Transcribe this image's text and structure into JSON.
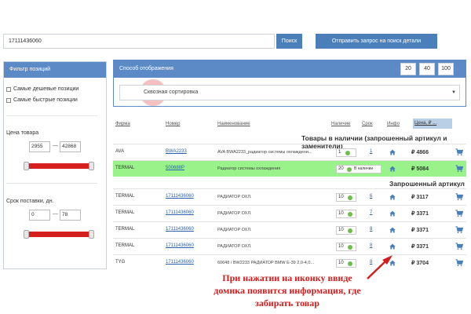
{
  "search": {
    "value": "17111436060",
    "button_label": "Поиск"
  },
  "request_button_label": "Отправить запрос на поиск детали",
  "filter": {
    "title": "Фильтр позиций",
    "options": [
      "Самые дешевые позиции",
      "Самые быстрые позиции"
    ],
    "price_label": "Цена товара",
    "price_min": "2955",
    "price_max": "42868",
    "delivery_label": "Срок поставки, дн.",
    "delivery_min": "0",
    "delivery_max": "78"
  },
  "display": {
    "title": "Способ отображения",
    "page_sizes": [
      "20",
      "40",
      "100"
    ],
    "mode_value": "Сквозная сортировка"
  },
  "table": {
    "headers": {
      "brand": "Фирма",
      "number": "Номер",
      "name": "Наименование",
      "availability": "Наличие",
      "term": "Срок",
      "info": "Инфо",
      "price": "Цена, ₽ ..."
    },
    "section_in_stock": "Товары в наличии (запрошенный артикул и заменители)",
    "section_requested": "Запрошенный артикул",
    "rows_in_stock": [
      {
        "brand": "AVA",
        "number": "BWA2233",
        "name": "AVA BWA2233_радиатор системы охлаждени...",
        "qty": "1",
        "term": "1",
        "price": "₽ 4866"
      },
      {
        "brand": "TERMAL",
        "number": "500688P",
        "name": "Радиатор системы охлаждения",
        "qty": "20",
        "availability_text": "В наличии",
        "price": "₽ 5084"
      }
    ],
    "rows_requested": [
      {
        "brand": "TERMAL",
        "number": "17111436060",
        "name": "РАДИАТОР ОХЛ.",
        "qty": "10",
        "term": "6",
        "price": "₽ 3117"
      },
      {
        "brand": "TERMAL",
        "number": "17111436060",
        "name": "РАДИАТОР ОХЛ.",
        "qty": "10",
        "term": "7",
        "price": "₽ 3371"
      },
      {
        "brand": "TERMAL",
        "number": "17111436060",
        "name": "РАДИАТОР ОХЛ.",
        "qty": "10",
        "term": "8",
        "price": "₽ 3371"
      },
      {
        "brand": "TERMAL",
        "number": "17111436060",
        "name": "РАДИАТОР ОХЛ.",
        "qty": "10",
        "term": "8",
        "price": "₽ 3371"
      },
      {
        "brand": "TYG",
        "number": "17111436060",
        "name": "60648 / BW2233 РАДИАТОР BMW E-39 2,0-4,0...",
        "qty": "10",
        "term": "8",
        "price": "₽ 3704"
      }
    ]
  },
  "annotation": {
    "lines": [
      "При нажатии на иконку ввиде",
      "домика появится информация, где",
      "забирать товар"
    ]
  },
  "colors": {
    "header_blue": "#5c8ac6",
    "button_blue": "#4a7fb9",
    "slider_red": "#d61f1f",
    "highlight_green": "#99f28a",
    "annotation_red": "#d41c1c",
    "status_dot": "#6cc04a"
  },
  "icons": {
    "info": "house-icon",
    "cart": "cart-icon"
  }
}
